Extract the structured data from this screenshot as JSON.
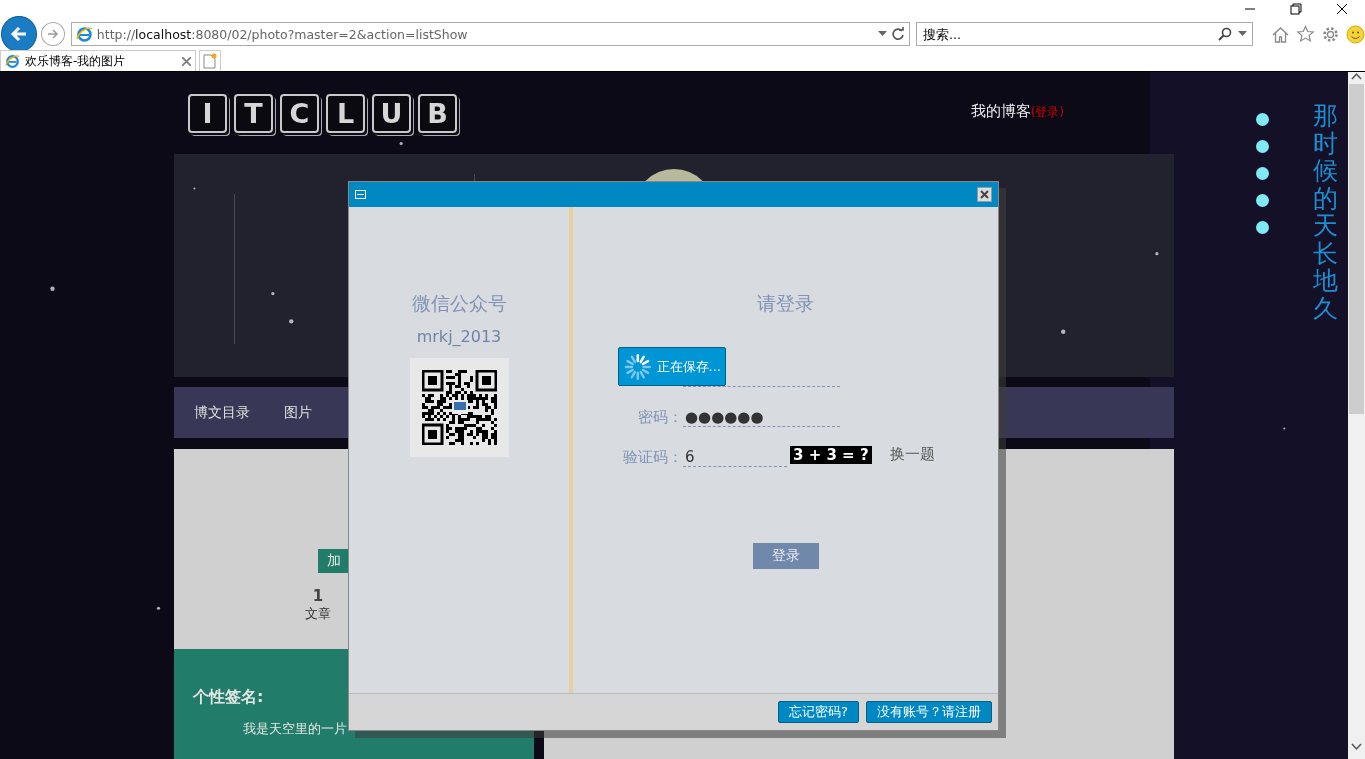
{
  "browser": {
    "url": "http://**localhost**:8080/02/photo?master=2&action=listShow",
    "search": {
      "placeholder": "搜索..."
    },
    "tabs": [
      {
        "title": "欢乐博客-我的图片",
        "selected": true
      }
    ]
  },
  "page": {
    "logo": [
      "I",
      "T",
      "C",
      "L",
      "U",
      "B"
    ],
    "blog_link": "我的博客",
    "login_link": "(登录)",
    "nav": [
      "博文目录",
      "图片"
    ],
    "profile": {
      "follow_button": "加",
      "stats": [
        {
          "value": "1",
          "label": "文章"
        }
      ]
    },
    "signature": {
      "heading": "个性签名:",
      "text": "我是天空里的一片"
    },
    "vertical_title": "那时候的天长地久"
  },
  "dialog": {
    "wechat": {
      "title": "微信公众号",
      "account": "mrkj_2013"
    },
    "login": {
      "title": "请登录",
      "saving_message": "正在保存...",
      "fields": [
        {
          "kind": "username"
        },
        {
          "kind": "password",
          "label": "密码：",
          "value": "●●●●●●"
        },
        {
          "kind": "captcha",
          "label": "验证码：",
          "value": "6",
          "captcha": "3 + 3 = ?",
          "refresh": "换一题"
        }
      ],
      "submit": "登录"
    },
    "footer_buttons": [
      "忘记密码?",
      "没有账号？请注册"
    ]
  }
}
